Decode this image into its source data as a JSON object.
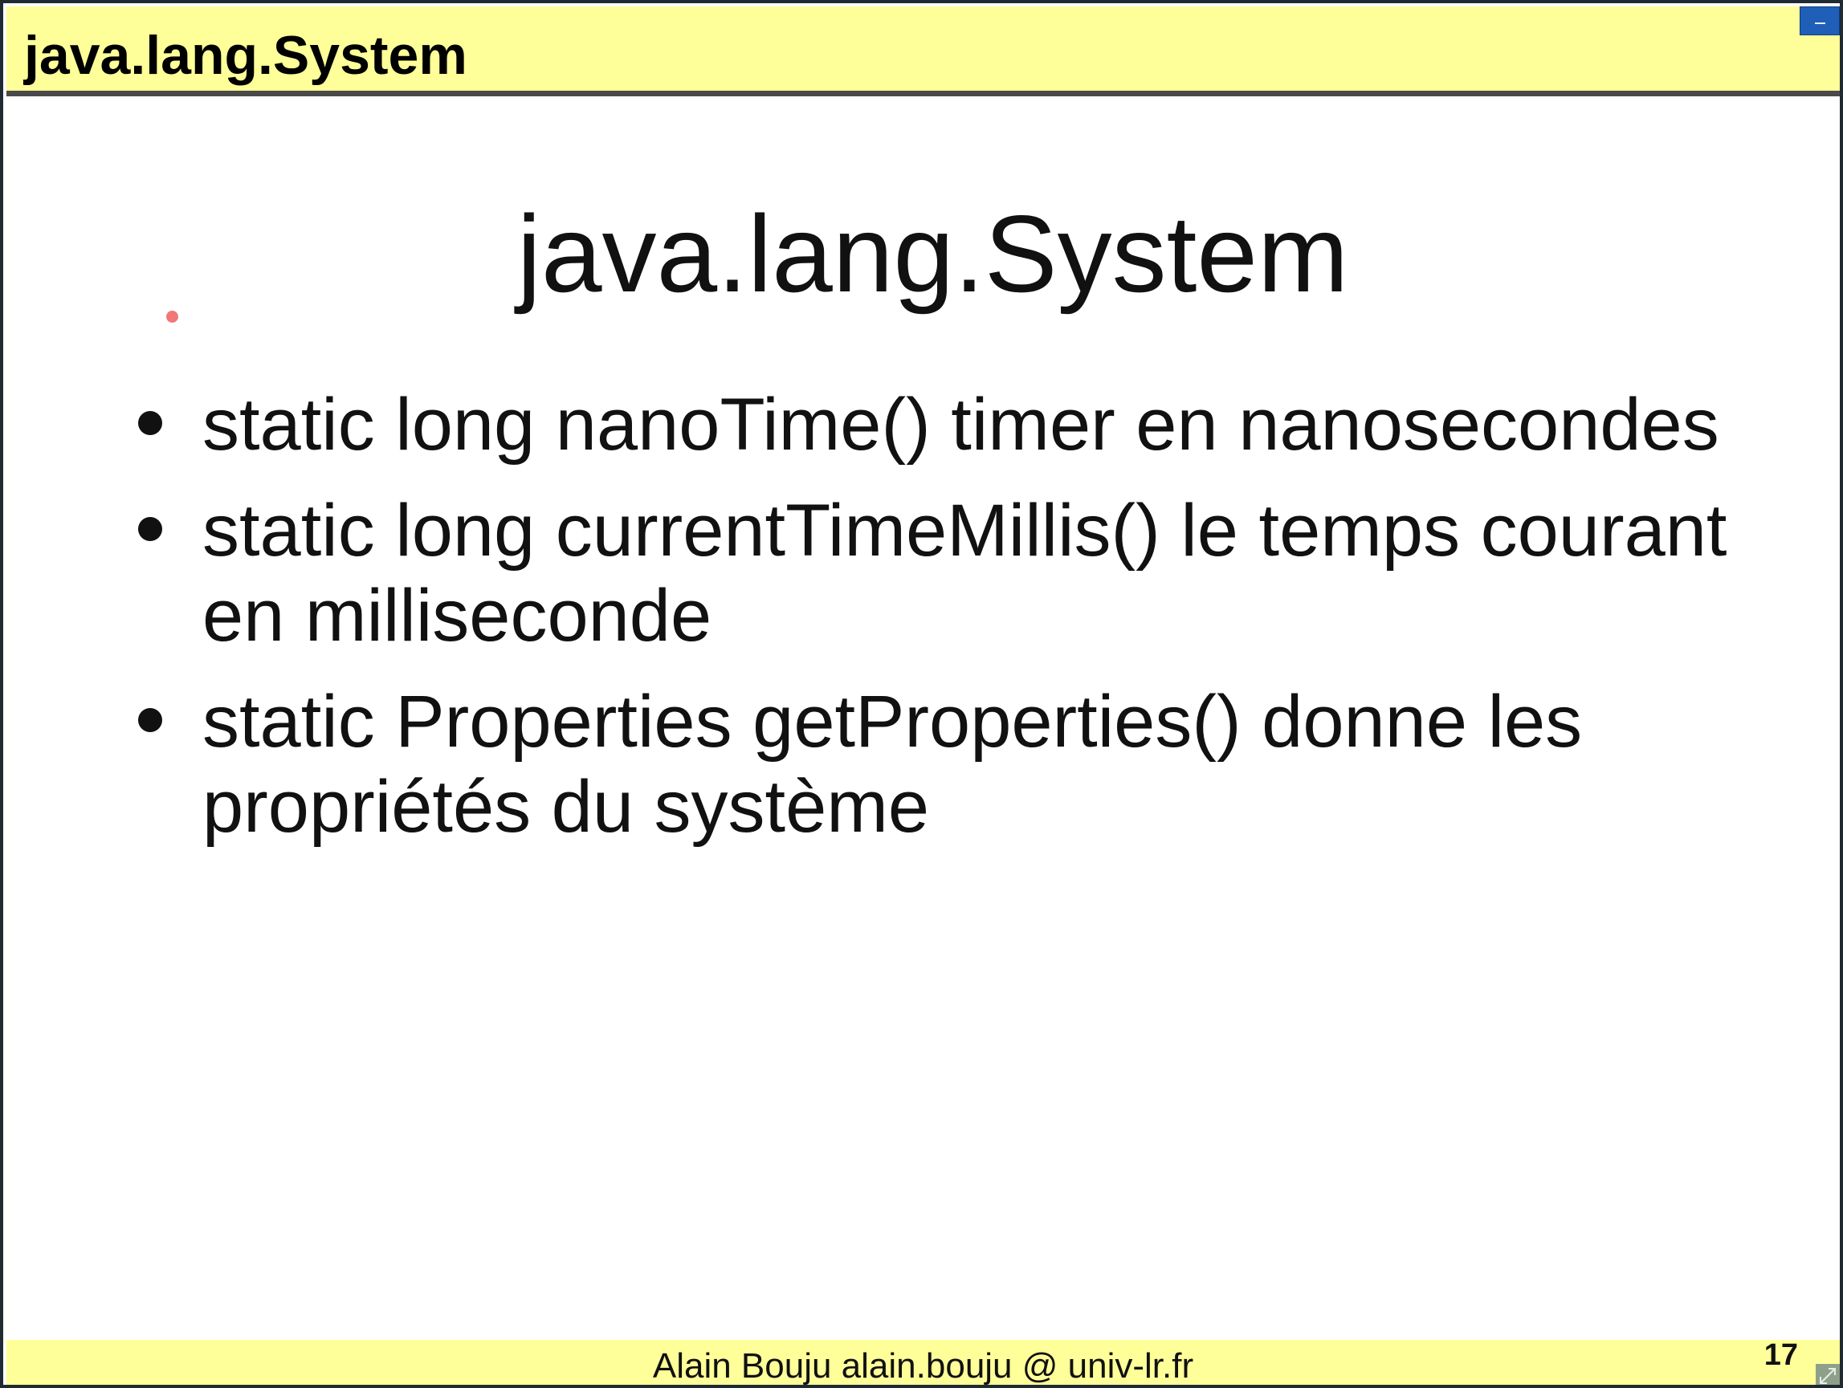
{
  "header": {
    "title": "java.lang.System"
  },
  "slide": {
    "heading": "java.lang.System",
    "bullets": [
      {
        "text": "static long nanoTime() timer en nanosecondes"
      },
      {
        "text": "static long currentTimeMillis() le temps courant en milliseconde"
      },
      {
        "text": "static Properties getProperties() donne les propriétés du système"
      }
    ]
  },
  "footer": {
    "author": "Alain Bouju alain.bouju @ univ-lr.fr",
    "page_number": "17"
  },
  "colors": {
    "bar_background": "#ffff99",
    "text": "#111111",
    "pointer": "#f07878",
    "minimize_button": "#1f5fb8"
  }
}
